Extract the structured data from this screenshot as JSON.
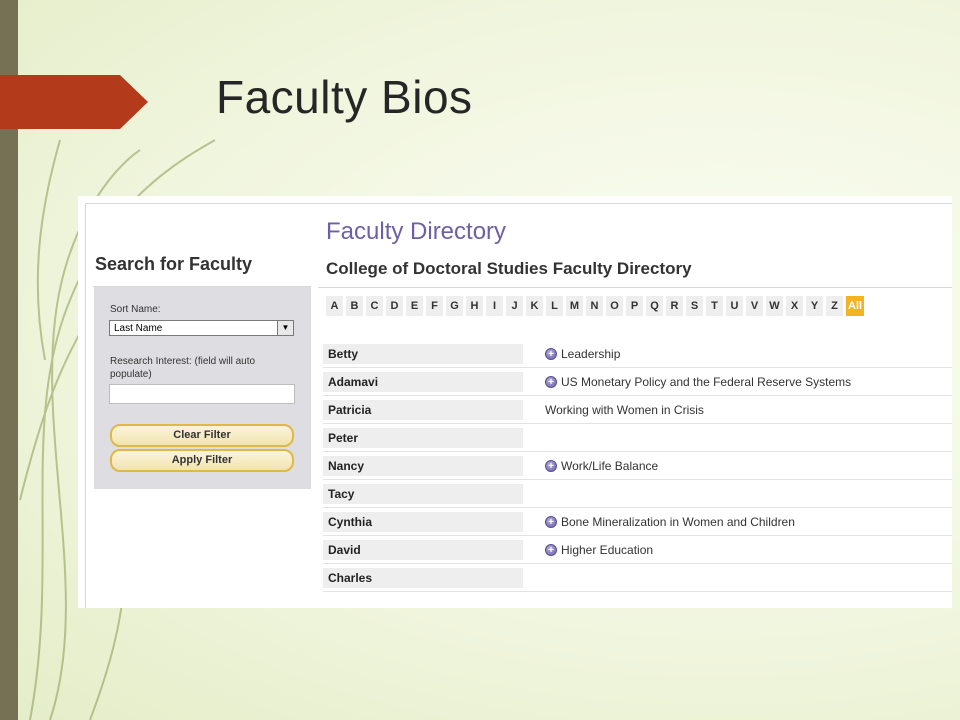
{
  "slide": {
    "title": "Faculty Bios"
  },
  "screenshot": {
    "directory_title": "Faculty Directory",
    "left_heading": "Search for Faculty",
    "sort_label": "Sort Name:",
    "sort_value": "Last Name",
    "research_label_line1": "Research Interest: (field will auto",
    "research_label_line2": "populate)",
    "research_value": "",
    "clear_filter": "Clear Filter",
    "apply_filter": "Apply Filter",
    "subtitle": "College of Doctoral Studies Faculty Directory",
    "letters": [
      "A",
      "B",
      "C",
      "D",
      "E",
      "F",
      "G",
      "H",
      "I",
      "J",
      "K",
      "L",
      "M",
      "N",
      "O",
      "P",
      "Q",
      "R",
      "S",
      "T",
      "U",
      "V",
      "W",
      "X",
      "Y",
      "Z",
      "All"
    ],
    "active_letter": "All",
    "faculty": [
      {
        "name": "Betty",
        "interest": "Leadership",
        "icon": true
      },
      {
        "name": "Adamavi",
        "interest": "US Monetary Policy and the Federal Reserve Systems",
        "icon": true
      },
      {
        "name": "Patricia",
        "interest": "Working with Women in Crisis",
        "icon": false
      },
      {
        "name": "Peter",
        "interest": "",
        "icon": false
      },
      {
        "name": "Nancy",
        "interest": "Work/Life Balance",
        "icon": true
      },
      {
        "name": "Tacy",
        "interest": "",
        "icon": false
      },
      {
        "name": "Cynthia",
        "interest": "Bone Mineralization in Women and Children",
        "icon": true
      },
      {
        "name": "David",
        "interest": "Higher Education",
        "icon": true
      },
      {
        "name": "Charles",
        "interest": "",
        "icon": false
      }
    ]
  },
  "colors": {
    "accent_arrow": "#b33a1a",
    "side_bar": "#767154",
    "directory_purple": "#6f5fa6",
    "active_letter": "#f5b41f"
  },
  "icons": {
    "expand": "plus-circle-icon",
    "dropdown": "dropdown-arrow-icon"
  }
}
